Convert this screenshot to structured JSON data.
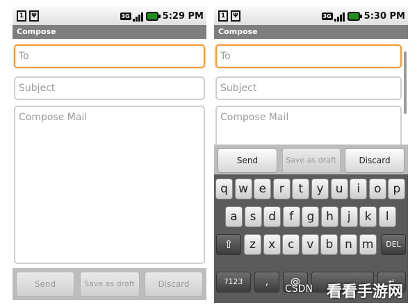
{
  "left": {
    "status": {
      "sim": "1",
      "network": "3G",
      "time": "5:29 PM"
    },
    "title": "Compose",
    "to_placeholder": "To",
    "subject_placeholder": "Subject",
    "body_placeholder": "Compose Mail",
    "buttons": {
      "send": "Send",
      "save_draft": "Save as draft",
      "discard": "Discard"
    }
  },
  "right": {
    "status": {
      "sim": "1",
      "network": "3G",
      "time": "5:30 PM"
    },
    "title": "Compose",
    "to_placeholder": "To",
    "subject_placeholder": "Subject",
    "body_placeholder": "Compose Mail",
    "buttons": {
      "send": "Send",
      "save_draft": "Save as draft",
      "discard": "Discard"
    }
  },
  "keyboard": {
    "row1": [
      "q",
      "w",
      "e",
      "r",
      "t",
      "y",
      "u",
      "i",
      "o",
      "p"
    ],
    "row2": [
      "a",
      "s",
      "d",
      "f",
      "g",
      "h",
      "j",
      "k",
      "l"
    ],
    "row3": [
      "z",
      "x",
      "c",
      "v",
      "b",
      "n",
      "m"
    ],
    "shift": "⇧",
    "del": "DEL",
    "sym": "?123",
    "comma": ",",
    "at": "@"
  },
  "watermark": {
    "csdn": "CSDN",
    "site": "看看手游网"
  }
}
